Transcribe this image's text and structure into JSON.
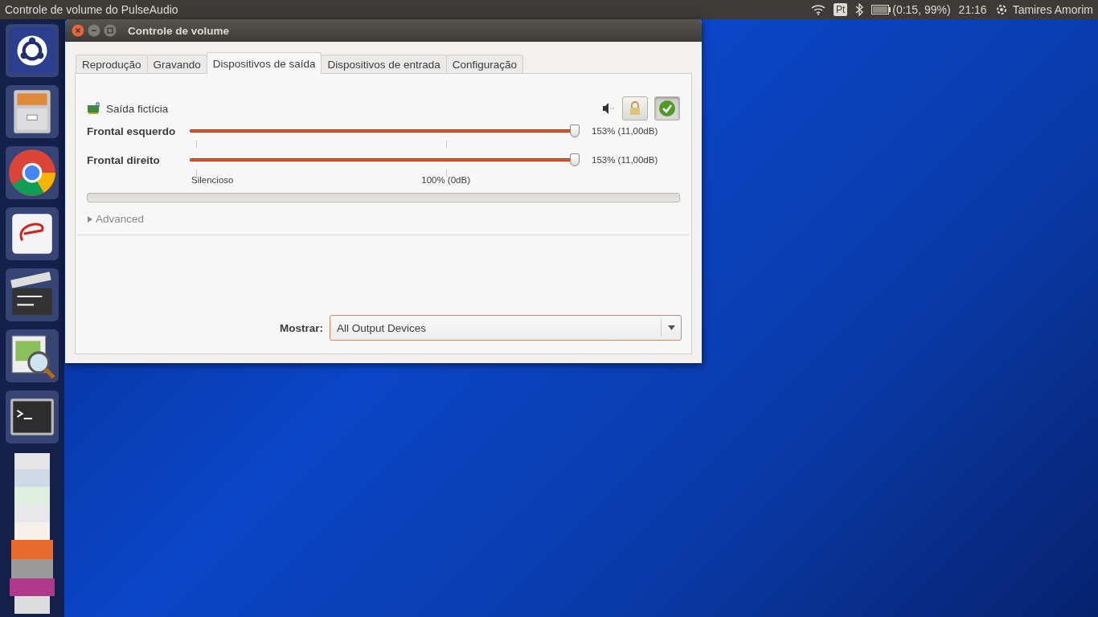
{
  "top_panel": {
    "app_title": "Controle de volume do PulseAudio",
    "keyboard": "Pt",
    "battery": "(0:15, 99%)",
    "clock": "21:16",
    "user": "Tamires Amorim"
  },
  "launcher": [
    {
      "kind": "ubuntu"
    },
    {
      "kind": "files"
    },
    {
      "kind": "browser"
    },
    {
      "kind": "reader"
    },
    {
      "kind": "video"
    },
    {
      "kind": "viewer"
    },
    {
      "kind": "terminal"
    },
    {
      "kind": "stack"
    }
  ],
  "window": {
    "title": "Controle de volume",
    "tabs": [
      {
        "label": "Reprodução",
        "selected": false
      },
      {
        "label": "Gravando",
        "selected": false
      },
      {
        "label": "Dispositivos de saída",
        "selected": true
      },
      {
        "label": "Dispositivos de entrada",
        "selected": false
      },
      {
        "label": "Configuração",
        "selected": false
      }
    ],
    "device": {
      "name": "Saída fictícia",
      "muted": false,
      "locked": false,
      "default": true,
      "channels": [
        {
          "name": "Frontal esquerdo",
          "level": 0.99,
          "reading": "153% (11,00dB)"
        },
        {
          "name": "Frontal direito",
          "level": 0.99,
          "reading": "153% (11,00dB)"
        }
      ],
      "scale_labels": [
        "Silencioso",
        "100% (0dB)"
      ],
      "advanced": {
        "label": "Advanced",
        "expanded": false
      }
    },
    "show": {
      "label": "Mostrar:",
      "value": "All Output Devices"
    }
  }
}
